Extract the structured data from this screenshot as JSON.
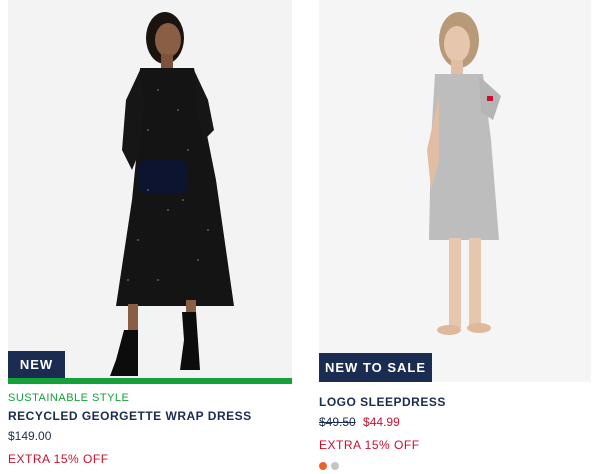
{
  "products": [
    {
      "badge": "NEW",
      "eyebrow": "SUSTAINABLE STYLE",
      "title": "RECYCLED GEORGETTE WRAP DRESS",
      "price": "$149.00",
      "promo": "EXTRA 15% OFF"
    },
    {
      "badge": "NEW TO SALE",
      "title": "LOGO SLEEPDRESS",
      "price_original": "$49.50",
      "price_sale": "$44.99",
      "promo": "EXTRA 15% OFF",
      "swatches": [
        "#e8642b",
        "#c4c4c4"
      ]
    }
  ],
  "colors": {
    "navy": "#1b2c52",
    "green": "#13a13a",
    "red": "#c8102e"
  }
}
